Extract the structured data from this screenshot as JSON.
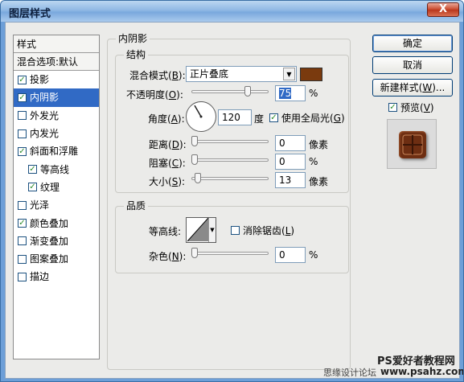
{
  "window": {
    "title": "图层样式",
    "close_label": "X"
  },
  "style_list": {
    "header": "样式",
    "blend_options": "混合选项:默认",
    "items": [
      {
        "label": "投影",
        "checked": true
      },
      {
        "label": "内阴影",
        "checked": true,
        "selected": true
      },
      {
        "label": "外发光",
        "checked": false
      },
      {
        "label": "内发光",
        "checked": false
      },
      {
        "label": "斜面和浮雕",
        "checked": true
      },
      {
        "label": "等高线",
        "checked": true,
        "sub": true
      },
      {
        "label": "纹理",
        "checked": true,
        "sub": true
      },
      {
        "label": "光泽",
        "checked": false
      },
      {
        "label": "颜色叠加",
        "checked": true
      },
      {
        "label": "渐变叠加",
        "checked": false
      },
      {
        "label": "图案叠加",
        "checked": false
      },
      {
        "label": "描边",
        "checked": false
      }
    ]
  },
  "inner_shadow": {
    "group_title": "内阴影",
    "structure": {
      "title": "结构",
      "blend_mode_label": "混合模式(",
      "blend_mode_key": "B",
      "blend_mode_value": "正片叠底",
      "shadow_color": "#7a3a0e",
      "opacity_label": "不透明度(",
      "opacity_key": "O",
      "opacity_value": "75",
      "opacity_unit": "%",
      "angle_label": "角度(",
      "angle_key": "A",
      "angle_value": "120",
      "angle_unit": "度",
      "global_light_label": "使用全局光(",
      "global_light_key": "G",
      "global_light_checked": true,
      "distance_label": "距离(",
      "distance_key": "D",
      "distance_value": "0",
      "distance_unit": "像素",
      "choke_label": "阻塞(",
      "choke_key": "C",
      "choke_value": "0",
      "choke_unit": "%",
      "size_label": "大小(",
      "size_key": "S",
      "size_value": "13",
      "size_unit": "像素"
    },
    "quality": {
      "title": "品质",
      "contour_label": "等高线:",
      "anti_alias_label": "消除锯齿(",
      "anti_alias_key": "L",
      "anti_alias_checked": false,
      "noise_label": "杂色(",
      "noise_key": "N",
      "noise_value": "0",
      "noise_unit": "%"
    }
  },
  "buttons": {
    "ok": "确定",
    "cancel": "取消",
    "new_style": "新建样式(",
    "new_style_key": "W",
    "new_style_suffix": ")...",
    "preview_label": "预览(",
    "preview_key": "V",
    "preview_checked": true
  },
  "levels": {
    "opacity_fraction": 0.75,
    "distance_fraction": 0,
    "choke_fraction": 0,
    "size_fraction": 0.05,
    "noise_fraction": 0,
    "angle_degrees": 120
  },
  "watermark": {
    "line1": "PS爱好者教程网",
    "line2": "www.psahz.com",
    "forum": "思缘设计论坛"
  }
}
